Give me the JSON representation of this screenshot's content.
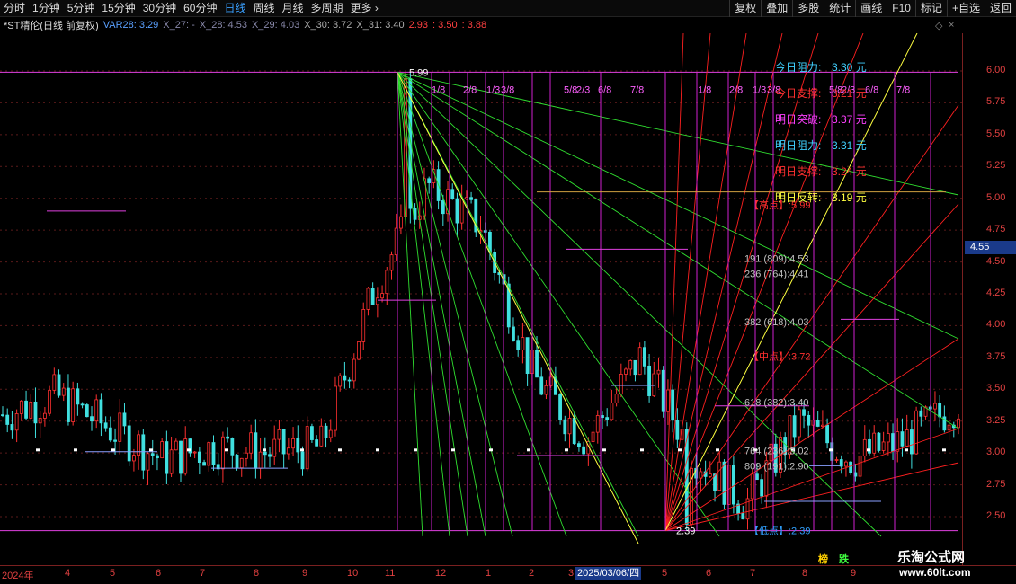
{
  "toolbar": {
    "periods": [
      "分时",
      "1分钟",
      "5分钟",
      "15分钟",
      "30分钟",
      "60分钟",
      "日线",
      "周线",
      "月线",
      "多周期",
      "更多 ›"
    ],
    "active_period": "日线",
    "buttons": [
      "复权",
      "叠加",
      "多股",
      "统计",
      "画线",
      "F10",
      "标记",
      "+自选",
      "返回"
    ]
  },
  "indicator_bar": {
    "title": "*ST精伦(日线 前复权)",
    "items": [
      {
        "text": "VAR28: 3.29",
        "color": "#5aa0ff"
      },
      {
        "text": "X_27: -",
        "color": "#8888aa"
      },
      {
        "text": "X_28: 4.53",
        "color": "#8888aa"
      },
      {
        "text": "X_29: 4.03",
        "color": "#8888aa"
      },
      {
        "text": "X_30: 3.72",
        "color": "#aaaaaa"
      },
      {
        "text": "X_31: 3.40",
        "color": "#aaaaaa"
      },
      {
        "text": "2.93",
        "color": "#ff4040"
      },
      {
        "text": ": 3.50",
        "color": "#ff4040"
      },
      {
        "text": ": 3.88",
        "color": "#ff4040"
      }
    ]
  },
  "price_axis": {
    "ticks": [
      "6.00",
      "5.75",
      "5.50",
      "5.25",
      "5.00",
      "4.75",
      "4.50",
      "4.25",
      "4.00",
      "3.75",
      "3.50",
      "3.25",
      "3.00",
      "2.75",
      "2.50"
    ],
    "current_price": "4.55"
  },
  "date_axis": {
    "labels": [
      "2024年",
      "4",
      "5",
      "6",
      "7",
      "8",
      "9",
      "10",
      "11",
      "12",
      "1",
      "2",
      "3",
      "5",
      "6",
      "7",
      "8",
      "9"
    ],
    "cursor_date": "2025/03/06/四"
  },
  "annotations": {
    "high_price": "5.99",
    "low_price": "2.39",
    "fractions_left": [
      "1/8",
      "2/8",
      "1/3",
      "3/8",
      "5/8",
      "2/3",
      "6/8",
      "7/8"
    ],
    "fractions_right": [
      "1/8",
      "2/8",
      "1/3",
      "3/8",
      "5/8",
      "2/3",
      "6/8",
      "7/8"
    ],
    "info_panel": [
      {
        "label": "今日阻力:",
        "value": "3.30 元",
        "color": "#40d0ff"
      },
      {
        "label": "今日支撑:",
        "value": "3.21 元",
        "color": "#ff3030"
      },
      {
        "label": "明日突破:",
        "value": "3.37 元",
        "color": "#ff40ff"
      },
      {
        "label": "明日阻力:",
        "value": "3.31 元",
        "color": "#40d0ff"
      },
      {
        "label": "明日支撑:",
        "value": "3.24 元",
        "color": "#ff3030"
      },
      {
        "label": "明日反转:",
        "value": "3.19 元",
        "color": "#ffff40"
      }
    ],
    "high_point": "【高点】:5.99",
    "mid_point": "【中点】:3.72",
    "low_point": "【低点】:2.39",
    "fib_levels": [
      {
        "text": "191 (809):4.53",
        "price": 4.53
      },
      {
        "text": "236 (764):4.41",
        "price": 4.41
      },
      {
        "text": "382 (618):4.03",
        "price": 4.03
      },
      {
        "text": "618 (382):3.40",
        "price": 3.4
      },
      {
        "text": "764 (236):3.02",
        "price": 3.02
      },
      {
        "text": "809 (191):2.90",
        "price": 2.9
      }
    ]
  },
  "badges": [
    {
      "text": "榜",
      "color": "#ffd000"
    },
    {
      "text": "跌",
      "color": "#40ff40"
    }
  ],
  "watermark": {
    "name": "乐淘公式网",
    "url": "www.60lt.com"
  },
  "chart_data": {
    "type": "candlestick",
    "symbol": "*ST精伦",
    "period": "日线",
    "ylim": [
      2.4,
      6.0
    ],
    "high": 5.99,
    "low": 2.39,
    "months": [
      "2024年",
      "4",
      "5",
      "6",
      "7",
      "8",
      "9",
      "10",
      "11",
      "12",
      "1",
      "2",
      "3",
      "4",
      "5",
      "6",
      "7",
      "8",
      "9"
    ],
    "monthly_close": [
      3.3,
      3.45,
      3.2,
      2.95,
      3.05,
      3.0,
      3.05,
      4.3,
      5.1,
      4.8,
      3.6,
      3.1,
      3.75,
      3.0,
      2.6,
      3.25,
      2.95,
      3.1,
      3.4
    ]
  }
}
